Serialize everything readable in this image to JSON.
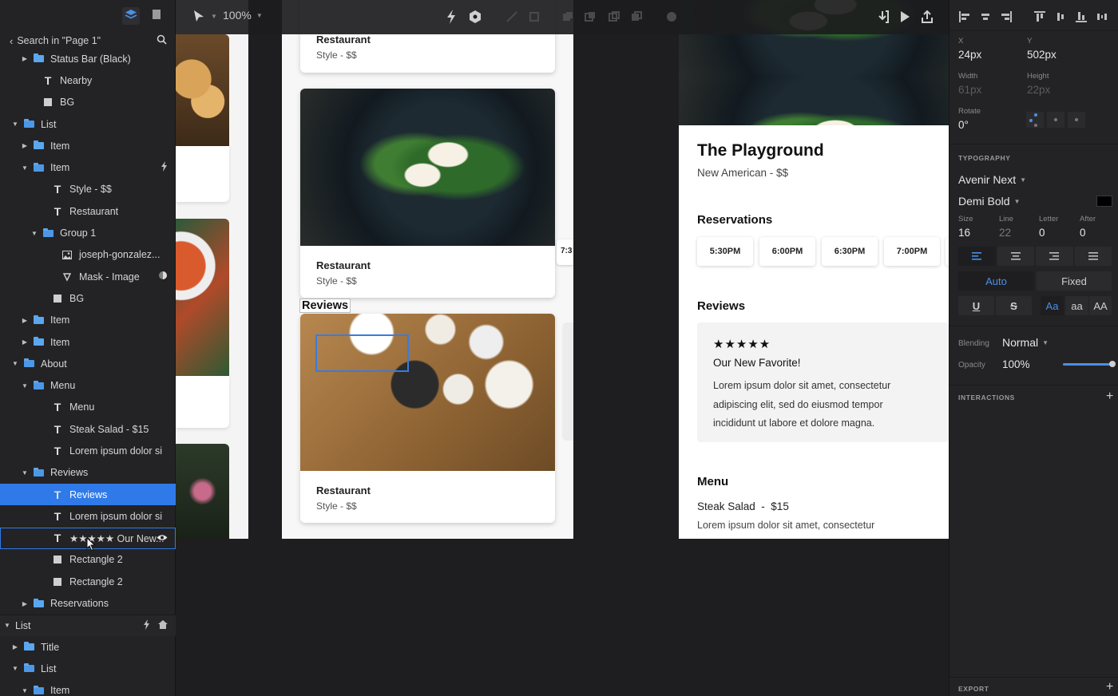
{
  "toolbar": {
    "zoom": "100%"
  },
  "left_panel": {
    "search_label": "Search in \"Page 1\"",
    "layers": [
      {
        "label": "Status Bar (Black)",
        "indent": 3,
        "caret": "right",
        "icon": "folder"
      },
      {
        "label": "Nearby",
        "indent": 4,
        "caret": "none",
        "icon": "text"
      },
      {
        "label": "BG",
        "indent": 4,
        "caret": "none",
        "icon": "rect"
      },
      {
        "label": "List",
        "indent": 2,
        "caret": "down",
        "icon": "folder-open"
      },
      {
        "label": "Item",
        "indent": 3,
        "caret": "right",
        "icon": "folder"
      },
      {
        "label": "Item",
        "indent": 3,
        "caret": "down",
        "icon": "folder-open",
        "right": "bolt"
      },
      {
        "label": "Style - $$",
        "indent": 5,
        "caret": "none",
        "icon": "text"
      },
      {
        "label": "Restaurant",
        "indent": 5,
        "caret": "none",
        "icon": "text"
      },
      {
        "label": "Group 1",
        "indent": 4,
        "caret": "down",
        "icon": "folder-open"
      },
      {
        "label": "joseph-gonzalez...",
        "indent": 6,
        "caret": "none",
        "icon": "image"
      },
      {
        "label": "Mask - Image",
        "indent": 6,
        "caret": "none",
        "icon": "mask",
        "right": "mask-toggle"
      },
      {
        "label": "BG",
        "indent": 5,
        "caret": "none",
        "icon": "rect"
      },
      {
        "label": "Item",
        "indent": 3,
        "caret": "right",
        "icon": "folder"
      },
      {
        "label": "Item",
        "indent": 3,
        "caret": "right",
        "icon": "folder"
      },
      {
        "label": "About",
        "indent": 2,
        "caret": "down",
        "icon": "folder-open"
      },
      {
        "label": "Menu",
        "indent": 3,
        "caret": "down",
        "icon": "folder-open"
      },
      {
        "label": "Menu",
        "indent": 5,
        "caret": "none",
        "icon": "text"
      },
      {
        "label": "Steak Salad - $15",
        "indent": 5,
        "caret": "none",
        "icon": "text"
      },
      {
        "label": "Lorem ipsum dolor si",
        "indent": 5,
        "caret": "none",
        "icon": "text"
      },
      {
        "label": "Reviews",
        "indent": 3,
        "caret": "down",
        "icon": "folder-open"
      },
      {
        "label": "Reviews",
        "indent": 5,
        "caret": "none",
        "icon": "text",
        "state": "selected"
      },
      {
        "label": "Lorem ipsum dolor si",
        "indent": 5,
        "caret": "none",
        "icon": "text"
      },
      {
        "label": "★★★★★ Our New...",
        "indent": 5,
        "caret": "none",
        "icon": "text",
        "state": "hovered",
        "right": "eye"
      },
      {
        "label": "Rectangle 2",
        "indent": 5,
        "caret": "none",
        "icon": "rect"
      },
      {
        "label": "Rectangle 2",
        "indent": 5,
        "caret": "none",
        "icon": "rect"
      },
      {
        "label": "Reservations",
        "indent": 3,
        "caret": "right",
        "icon": "folder"
      },
      {
        "label": "List",
        "indent": 1,
        "caret": "down",
        "icon": "none",
        "right": "bolt-home",
        "section": true
      },
      {
        "label": "Title",
        "indent": 2,
        "caret": "right",
        "icon": "folder"
      },
      {
        "label": "List",
        "indent": 2,
        "caret": "down",
        "icon": "folder-open"
      },
      {
        "label": "Item",
        "indent": 3,
        "caret": "down",
        "icon": "folder-open"
      }
    ]
  },
  "canvas": {
    "mid_cards": [
      {
        "title": "Restaurant",
        "subtitle": "Style - $$"
      },
      {
        "title": "Restaurant",
        "subtitle": "Style - $$"
      },
      {
        "title": "Restaurant",
        "subtitle": "Style - $$"
      }
    ],
    "reviews_overlay_label": "Reviews",
    "side_peek_time": "7:3",
    "detail": {
      "name": "The Playground",
      "category": "New American - $$",
      "reservations_title": "Reservations",
      "times": [
        "5:30PM",
        "6:00PM",
        "6:30PM",
        "7:00PM"
      ],
      "reviews_title": "Reviews",
      "review_stars": "★★★★★",
      "review_title": "Our New Favorite!",
      "review_body": "Lorem ipsum dolor sit amet, consectetur adipiscing elit, sed do eiusmod tempor incididunt ut labore et dolore magna.",
      "menu_title": "Menu",
      "menu_item": "Steak Salad  -  $15",
      "menu_desc": "Lorem ipsum dolor sit amet, consectetur"
    }
  },
  "inspector": {
    "x_label": "X",
    "x_value": "24px",
    "y_label": "Y",
    "y_value": "502px",
    "width_label": "Width",
    "width_value": "61px",
    "height_label": "Height",
    "height_value": "22px",
    "rotate_label": "Rotate",
    "rotate_value": "0°",
    "typography_title": "TYPOGRAPHY",
    "font_family": "Avenir Next",
    "font_weight": "Demi Bold",
    "text_color": "#000000",
    "size_label": "Size",
    "size_value": "16",
    "line_label": "Line",
    "line_value": "22",
    "letter_label": "Letter",
    "letter_value": "0",
    "after_label": "After",
    "after_value": "0",
    "auto_label": "Auto",
    "fixed_label": "Fixed",
    "case_options": [
      "Aa",
      "aa",
      "AA"
    ],
    "blending_label": "Blending",
    "blending_value": "Normal",
    "opacity_label": "Opacity",
    "opacity_value": "100%",
    "opacity_fraction": 1.0,
    "interactions_title": "INTERACTIONS",
    "export_title": "EXPORT"
  },
  "colors": {
    "accent": "#2f7ae8",
    "panel": "#232325",
    "canvas": "#1e1e20"
  }
}
